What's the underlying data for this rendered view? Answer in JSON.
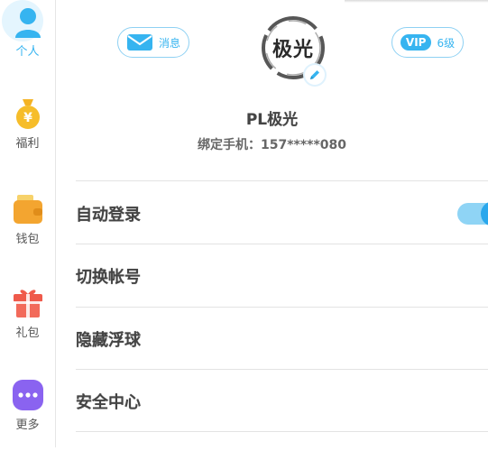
{
  "sidebar": {
    "items": [
      {
        "label": "个人",
        "icon": "person-icon",
        "active": true
      },
      {
        "label": "福利",
        "icon": "money-bag-icon",
        "active": false
      },
      {
        "label": "钱包",
        "icon": "wallet-icon",
        "active": false
      },
      {
        "label": "礼包",
        "icon": "gift-icon",
        "active": false
      },
      {
        "label": "更多",
        "icon": "more-dots-icon",
        "active": false
      }
    ]
  },
  "header": {
    "message_label": "消息",
    "vip_badge": "VIP",
    "vip_level": "6级",
    "avatar_text": "极光",
    "username": "PL极光",
    "phone": "绑定手机：157*****080"
  },
  "settings": {
    "items": [
      {
        "label": "自动登录",
        "toggle_on": true
      },
      {
        "label": "切换帐号"
      },
      {
        "label": "隐藏浮球"
      },
      {
        "label": "安全中心"
      }
    ]
  },
  "colors": {
    "accent": "#36b4f0",
    "accent_light": "#8fd1f3",
    "active_bg": "#e4f5fe",
    "gold": "#f4b324",
    "wallet": "#f3a530",
    "gift": "#ef5a4b",
    "more": "#8a63f0"
  }
}
